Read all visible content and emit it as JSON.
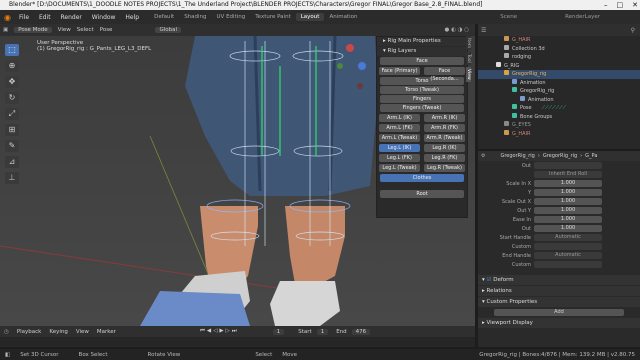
{
  "window": {
    "title": "Blender* [D:\\DOCUMENTS\\1_DOODLE NOTES PROJECTS\\1_The Underland Project\\BLENDER PROJECTS\\Characters\\Gregor FINAL\\Gregor Base_2.8_FINAL.blend]"
  },
  "menu": [
    "File",
    "Edit",
    "Render",
    "Window",
    "Help"
  ],
  "workspaces": [
    "Default",
    "Shading",
    "UV Editing",
    "Texture Paint",
    "Layout",
    "Animation"
  ],
  "workspace_active": "Layout",
  "scene": {
    "scene_label": "Scene",
    "renderlayer_label": "RenderLayer"
  },
  "viewport": {
    "mode": "Pose Mode",
    "view": "View",
    "select": "Select",
    "pose": "Pose",
    "orientation": "Global",
    "info_line1": "User Perspective",
    "info_line2": "(1) GregorRig_rig : G_Pants_LEG_L3_DEFL"
  },
  "rig_panel": {
    "main_properties": "Rig Main Properties",
    "layers_title": "Rig Layers",
    "buttons": {
      "face": "Face",
      "face_primary": "Face (Primary)",
      "face_secondary": "Face (Seconda...",
      "torso": "Torso",
      "torso_tweak": "Torso (Tweak)",
      "fingers": "Fingers",
      "fingers_tweak": "Fingers (Tweak)",
      "arm_l_ik": "Arm.L (IK)",
      "arm_r_ik": "Arm.R (IK)",
      "arm_l_fk": "Arm.L (FK)",
      "arm_r_fk": "Arm.R (FK)",
      "arm_l_tweak": "Arm.L (Tweak)",
      "arm_r_tweak": "Arm.R (Tweak)",
      "leg_l_ik": "Leg.L (IK)",
      "leg_r_ik": "Leg.R (IK)",
      "leg_l_fk": "Leg.L (FK)",
      "leg_r_fk": "Leg.R (FK)",
      "leg_l_tweak": "Leg.L (Tweak)",
      "leg_r_tweak": "Leg.R (Tweak)",
      "clothes": "Clothes",
      "root": "Root"
    }
  },
  "side_tabs": [
    "Item",
    "Tool",
    "View"
  ],
  "outliner": {
    "rows": [
      "G_HAIR",
      "Collection 3d",
      "rodging",
      "G_RIG",
      "GregorRig_rig",
      "Animation",
      "GregorRig_rig",
      "Animation",
      "Pose",
      "Bone Groups",
      "G_EYES",
      "G_HAIR"
    ]
  },
  "properties": {
    "header_obj": "GregorRig_rig",
    "header_data": "GregorRig_rig",
    "header_extra": "G_Pa",
    "out_label": "Out",
    "inherit_end_roll": "Inherit End Roll",
    "rows": [
      {
        "label": "Scale In X",
        "value": "1.000"
      },
      {
        "label": "Y",
        "value": "1.000"
      },
      {
        "label": "Scale Out X",
        "value": "1.000"
      },
      {
        "label": "Out Y",
        "value": "1.000"
      },
      {
        "label": "Ease In",
        "value": "1.000"
      },
      {
        "label": "Out",
        "value": "1.000"
      }
    ],
    "start_handle": {
      "label": "Start Handle",
      "value": "Automatic"
    },
    "custom_label": "Custom",
    "end_handle": {
      "label": "End Handle",
      "value": "Automatic"
    },
    "custom2_label": "Custom",
    "sections": [
      "Deform",
      "Relations",
      "Custom Properties",
      "Viewport Display"
    ],
    "add_label": "Add"
  },
  "timeline": {
    "playback": "Playback",
    "keying": "Keying",
    "view": "View",
    "marker": "Marker",
    "current_frame": "1",
    "start_label": "Start",
    "start": "1",
    "end_label": "End",
    "end": "476"
  },
  "status": {
    "set_cursor": "Set 3D Cursor",
    "box_select": "Box Select",
    "rotate_view": "Rotate View",
    "select": "Select",
    "move": "Move",
    "info": "GregorRig_rig | Bones:4/876 | Mem: 139.2 MB | v2.80.75"
  }
}
